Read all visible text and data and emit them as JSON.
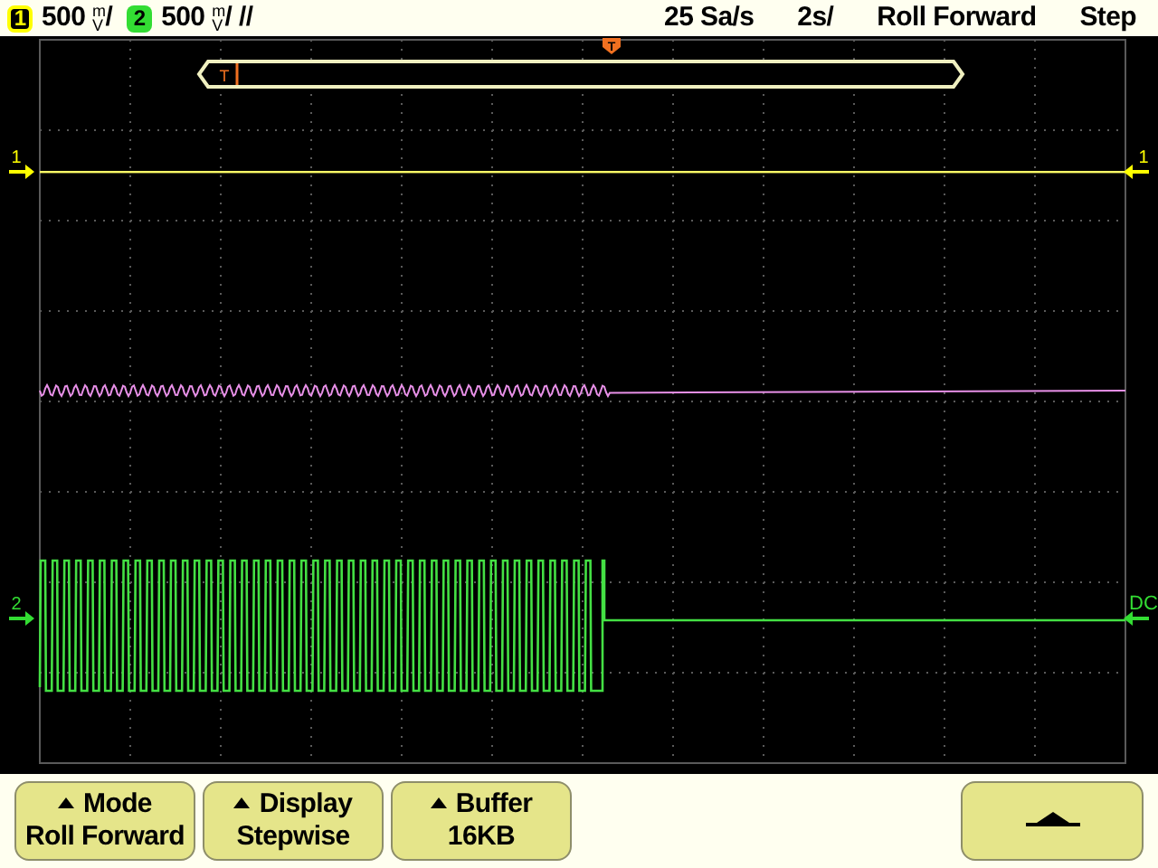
{
  "status_bar": {
    "channels": [
      {
        "number": "1",
        "color": "#ffff00",
        "scale": "500",
        "unit_top": "m",
        "unit_bottom": "V",
        "suffix": "/"
      },
      {
        "number": "2",
        "color": "#33dd33",
        "scale": "500",
        "unit_top": "m",
        "unit_bottom": "V",
        "suffix": "/ //"
      }
    ],
    "sample_rate": "25 Sa/s",
    "timebase": "2s/",
    "mode": "Roll Forward",
    "state": "Step"
  },
  "display": {
    "trigger_marker": "T",
    "buffer_marker": "T",
    "markers": [
      {
        "label": "1",
        "kind": "left",
        "color": "#ffff00"
      },
      {
        "label": "1",
        "kind": "right",
        "color": "#ffff00"
      },
      {
        "label": "2",
        "kind": "left",
        "color": "#33dd33"
      },
      {
        "label": "DC",
        "kind": "right",
        "color": "#33dd33"
      }
    ],
    "traces": [
      {
        "kind": "flat",
        "color": "#ffff66"
      },
      {
        "kind": "ripple",
        "color": "#e890e8"
      },
      {
        "kind": "square",
        "color": "#44e044"
      }
    ]
  },
  "softkeys": [
    {
      "kind": "menu",
      "title": "Mode",
      "value": "Roll Forward"
    },
    {
      "kind": "menu",
      "title": "Display",
      "value": "Stepwise"
    },
    {
      "kind": "menu",
      "title": "Buffer",
      "value": "16KB"
    },
    {
      "kind": "back"
    }
  ]
}
